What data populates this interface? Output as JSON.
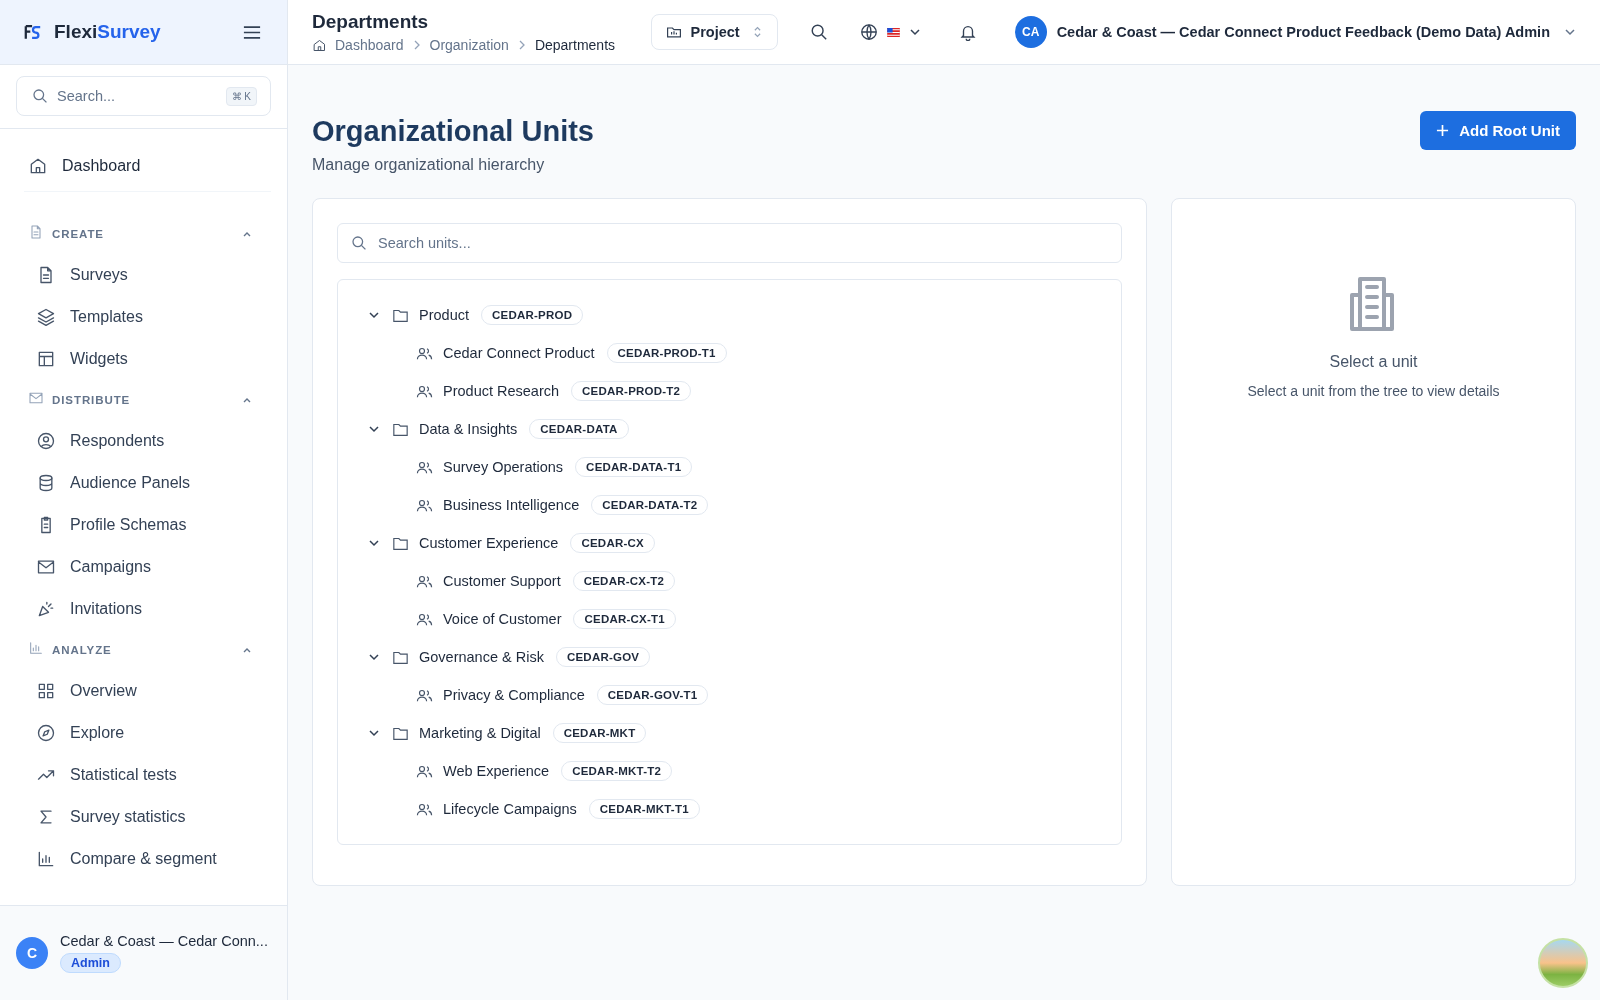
{
  "brand": {
    "prefix": "Flexi",
    "suffix": "Survey"
  },
  "sidebar": {
    "search": {
      "placeholder": "Search...",
      "shortcut": "⌘ K"
    },
    "top_item": {
      "label": "Dashboard"
    },
    "sections": [
      {
        "title": "CREATE",
        "expanded": true,
        "items": [
          "Surveys",
          "Templates",
          "Widgets"
        ]
      },
      {
        "title": "DISTRIBUTE",
        "expanded": true,
        "items": [
          "Respondents",
          "Audience Panels",
          "Profile Schemas",
          "Campaigns",
          "Invitations"
        ]
      },
      {
        "title": "ANALYZE",
        "expanded": true,
        "items": [
          "Overview",
          "Explore",
          "Statistical tests",
          "Survey statistics",
          "Compare & segment"
        ]
      }
    ],
    "account": {
      "initial": "C",
      "name": "Cedar & Coast — Cedar Conn...",
      "role": "Admin"
    }
  },
  "header": {
    "title": "Departments",
    "breadcrumbs": [
      "Dashboard",
      "Organization",
      "Departments"
    ],
    "project": "Project",
    "user_initials": "CA",
    "user_name": "Cedar & Coast — Cedar Connect Product Feedback (Demo Data) Admin"
  },
  "page": {
    "title": "Organizational Units",
    "subtitle": "Manage organizational hierarchy",
    "add_button": "Add Root Unit"
  },
  "tree": {
    "search_placeholder": "Search units...",
    "units": [
      {
        "name": "Product",
        "code": "CEDAR-PROD",
        "expanded": true,
        "children": [
          {
            "name": "Cedar Connect Product",
            "code": "CEDAR-PROD-T1"
          },
          {
            "name": "Product Research",
            "code": "CEDAR-PROD-T2"
          }
        ]
      },
      {
        "name": "Data & Insights",
        "code": "CEDAR-DATA",
        "expanded": true,
        "children": [
          {
            "name": "Survey Operations",
            "code": "CEDAR-DATA-T1"
          },
          {
            "name": "Business Intelligence",
            "code": "CEDAR-DATA-T2"
          }
        ]
      },
      {
        "name": "Customer Experience",
        "code": "CEDAR-CX",
        "expanded": true,
        "children": [
          {
            "name": "Customer Support",
            "code": "CEDAR-CX-T2"
          },
          {
            "name": "Voice of Customer",
            "code": "CEDAR-CX-T1"
          }
        ]
      },
      {
        "name": "Governance & Risk",
        "code": "CEDAR-GOV",
        "expanded": true,
        "children": [
          {
            "name": "Privacy & Compliance",
            "code": "CEDAR-GOV-T1"
          }
        ]
      },
      {
        "name": "Marketing & Digital",
        "code": "CEDAR-MKT",
        "expanded": true,
        "children": [
          {
            "name": "Web Experience",
            "code": "CEDAR-MKT-T2"
          },
          {
            "name": "Lifecycle Campaigns",
            "code": "CEDAR-MKT-T1"
          }
        ]
      }
    ]
  },
  "detail": {
    "title": "Select a unit",
    "hint": "Select a unit from the tree to view details"
  }
}
